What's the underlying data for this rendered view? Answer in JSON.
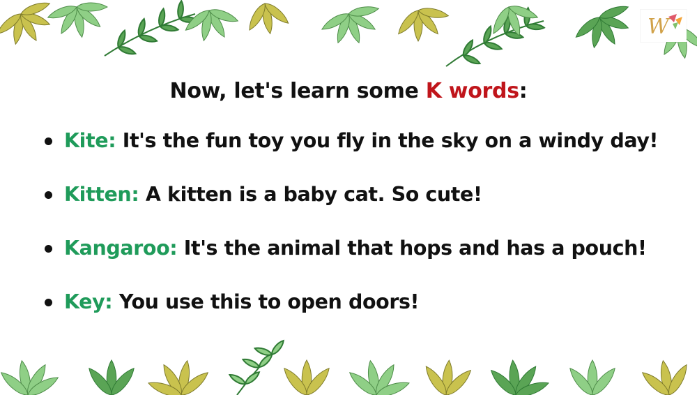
{
  "heading": {
    "prefix": "Now, let's learn some ",
    "highlight": "K words",
    "suffix": ":"
  },
  "words": [
    {
      "term": "Kite:",
      "definition": " It's the fun toy you fly in the sky on a windy day!"
    },
    {
      "term": "Kitten:",
      "definition": " A kitten is a baby cat. So cute!"
    },
    {
      "term": "Kangaroo:",
      "definition": " It's the animal that hops and has a pouch!"
    },
    {
      "term": "Key:",
      "definition": " You use this to open doors!"
    }
  ],
  "colors": {
    "term": "#1f9b5a",
    "highlight": "#c0151b",
    "text": "#111111",
    "leaf_light": "#8fcf86",
    "leaf_mid": "#5aa455",
    "leaf_dark": "#2f7a34",
    "leaf_olive": "#c9c24e"
  },
  "logo": {
    "icon": "w-monogram-logo-icon"
  }
}
